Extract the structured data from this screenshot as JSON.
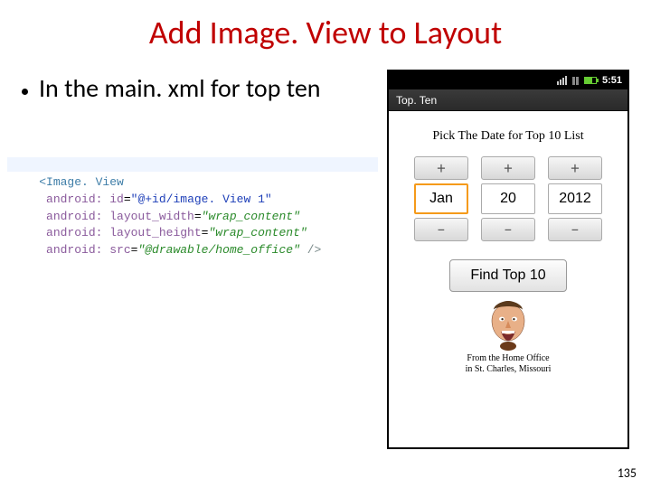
{
  "title": "Add Image. View to Layout",
  "bullet": "In the main. xml for top ten",
  "code": {
    "tag_open": "<Image. View",
    "attrs": [
      {
        "name": "android: id",
        "value": "\"@+id/image. View 1\"",
        "style": "blue"
      },
      {
        "name": "android: layout_width",
        "value": "\"wrap_content\"",
        "style": "green"
      },
      {
        "name": "android: layout_height",
        "value": "\"wrap_content\"",
        "style": "green"
      },
      {
        "name": "android: src",
        "value": "\"@drawable/home_office\"",
        "style": "green"
      }
    ],
    "tag_close": " />"
  },
  "phone": {
    "statusbar": {
      "time": "5:51"
    },
    "app_title": "Top. Ten",
    "prompt": "Pick The Date for Top 10 List",
    "picker": {
      "month": "Jan",
      "day": "20",
      "year": "2012",
      "plus": "+",
      "minus": "−"
    },
    "find_button": "Find Top 10",
    "home_office": {
      "line1": "From the Home Office",
      "line2": "in St. Charles, Missouri"
    }
  },
  "page_number": "135"
}
